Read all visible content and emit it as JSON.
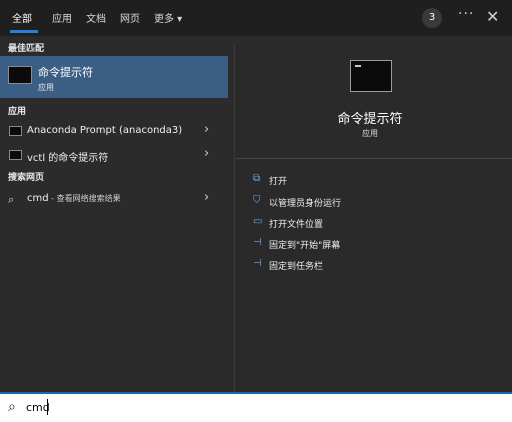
{
  "tabs": [
    "全部",
    "应用",
    "文档",
    "网页",
    "更多 ▾"
  ],
  "badge_count": "3",
  "more_label": "···",
  "close_label": "✕",
  "sections": {
    "best_match": "最佳匹配",
    "apps": "应用",
    "web": "搜索网页"
  },
  "best_match": {
    "title": "命令提示符",
    "subtitle": "应用"
  },
  "apps": [
    {
      "label": "Anaconda Prompt (anaconda3)",
      "chevron": "›"
    },
    {
      "label": "vctl 的命令提示符",
      "chevron": "›"
    }
  ],
  "web_result": {
    "query": "cmd",
    "suffix": " - 查看网络搜索结果",
    "chevron": "›"
  },
  "preview": {
    "title": "命令提示符",
    "subtitle": "应用",
    "actions": [
      {
        "label": "打开",
        "icon": "open-icon"
      },
      {
        "label": "以管理员身份运行",
        "icon": "shield-icon"
      },
      {
        "label": "打开文件位置",
        "icon": "folder-icon"
      },
      {
        "label": "固定到\"开始\"屏幕",
        "icon": "pin-icon"
      },
      {
        "label": "固定到任务栏",
        "icon": "pin-icon"
      }
    ]
  },
  "search": {
    "value": "cmd"
  },
  "colors": {
    "accent": "#2b80d6",
    "selected": "#3b5f84",
    "background": "#2b2b2b"
  }
}
